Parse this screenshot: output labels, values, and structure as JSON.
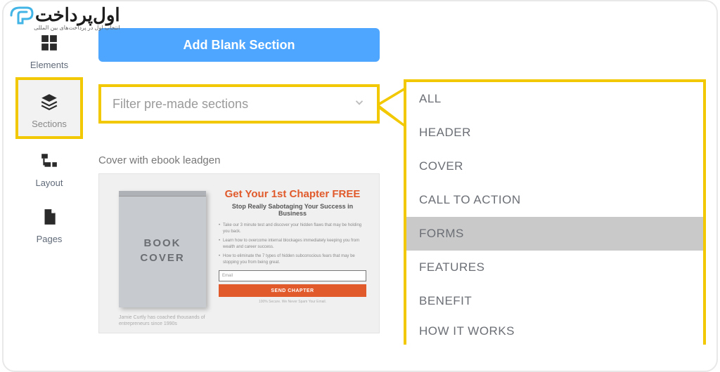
{
  "logo": {
    "brand_main": "اول‌پرداخت",
    "brand_sub": "انتخاب اول در پرداخت‌های بین المللی"
  },
  "sidebar": {
    "items": [
      {
        "icon": "elements-icon",
        "label": "Elements"
      },
      {
        "icon": "sections-icon",
        "label": "Sections"
      },
      {
        "icon": "layout-icon",
        "label": "Layout"
      },
      {
        "icon": "pages-icon",
        "label": "Pages"
      }
    ]
  },
  "main": {
    "add_button": "Add Blank Section",
    "filter_placeholder": "Filter pre-made sections",
    "card_title": "Cover with ebook leadgen",
    "book_line1": "BOOK",
    "book_line2": "COVER",
    "promo_head": "Get Your 1st Chapter FREE",
    "promo_sub": "Stop Really Sabotaging Your Success in Business",
    "bullets": [
      "Take our 3 minute test and discover your hidden flaws that may be holding you back.",
      "Learn how to overcome internal blockages immediately keeping you from wealth and career success.",
      "How to eliminate the 7 types of hidden subconscious fears that may be stopping you from being great."
    ],
    "email_ph": "Email",
    "send_label": "SEND CHAPTER",
    "secure_label": "100% Secure. We Never Spam Your Email.",
    "coach_line1": "Jamie Curtly has coached thousands of",
    "coach_line2": "entrepreneurs since 1990s"
  },
  "dropdown": {
    "items": [
      {
        "label": "ALL"
      },
      {
        "label": "HEADER"
      },
      {
        "label": "COVER"
      },
      {
        "label": "CALL TO ACTION"
      },
      {
        "label": "FORMS",
        "selected": true
      },
      {
        "label": "FEATURES"
      },
      {
        "label": "BENEFIT"
      },
      {
        "label": "HOW IT WORKS"
      }
    ]
  },
  "colors": {
    "highlight": "#f2c800",
    "primary_btn": "#4fa6ff",
    "accent": "#e05a2b"
  }
}
